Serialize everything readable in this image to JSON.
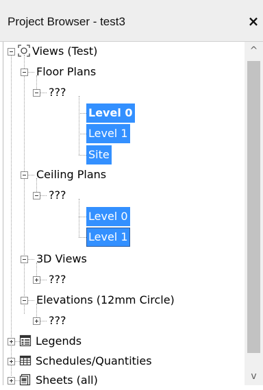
{
  "window": {
    "title": "Project Browser - test3",
    "close_glyph": "×"
  },
  "tree": {
    "root": "Views (Test)",
    "floor_plans": {
      "label": "Floor Plans",
      "group": "???",
      "items": [
        "Level 0",
        "Level 1",
        "Site"
      ]
    },
    "ceiling_plans": {
      "label": "Ceiling Plans",
      "group": "???",
      "items": [
        "Level 0",
        "Level 1"
      ]
    },
    "views_3d": {
      "label": "3D Views",
      "group": "???"
    },
    "elevations": {
      "label": "Elevations (12mm Circle)",
      "group": "???"
    },
    "legends": "Legends",
    "schedules": "Schedules/Quantities",
    "sheets": "Sheets (all)"
  },
  "scrollbar": {
    "up_glyph": "^",
    "down_glyph": "v"
  },
  "colors": {
    "selection": "#3390ff",
    "title_bar": "#eeeeee",
    "scroll_thumb": "#c2c2c2"
  }
}
